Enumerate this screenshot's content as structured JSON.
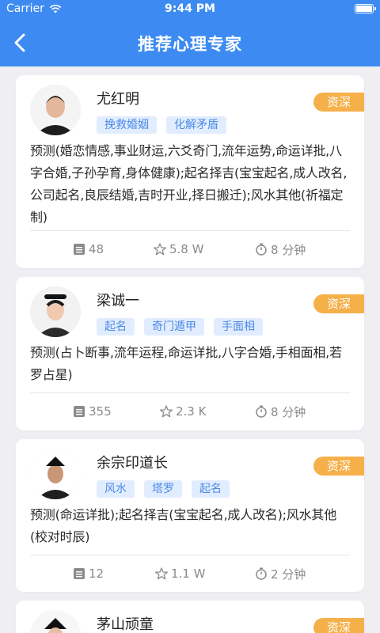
{
  "status": {
    "carrier": "Carrier",
    "time": "9:44 PM"
  },
  "nav": {
    "title": "推荐心理专家"
  },
  "experts": [
    {
      "name": "尤红明",
      "badge": "资深",
      "tags": [
        "挽救婚姻",
        "化解矛盾"
      ],
      "description": "预测(婚恋情感,事业财运,六爻奇门,流年运势,命运详批,八字合婚,子孙孕育,身体健康);起名择吉(宝宝起名,成人改名,公司起名,良辰结婚,吉时开业,择日搬迁);风水其他(祈福定制)",
      "stats": {
        "count": "48",
        "rating": "5.8 W",
        "time": "8 分钟"
      }
    },
    {
      "name": "梁诚一",
      "badge": "资深",
      "tags": [
        "起名",
        "奇门遁甲",
        "手面相"
      ],
      "description": "预测(占卜断事,流年运程,命运详批,八字合婚,手相面相,若罗占星)",
      "stats": {
        "count": "355",
        "rating": "2.3 K",
        "time": "8 分钟"
      }
    },
    {
      "name": "余宗印道长",
      "badge": "资深",
      "tags": [
        "风水",
        "塔罗",
        "起名"
      ],
      "description": "预测(命运详批);起名择吉(宝宝起名,成人改名);风水其他(校对时辰)",
      "stats": {
        "count": "12",
        "rating": "1.1 W",
        "time": "2 分钟"
      }
    },
    {
      "name": "茅山顽童",
      "badge": "资深"
    }
  ]
}
